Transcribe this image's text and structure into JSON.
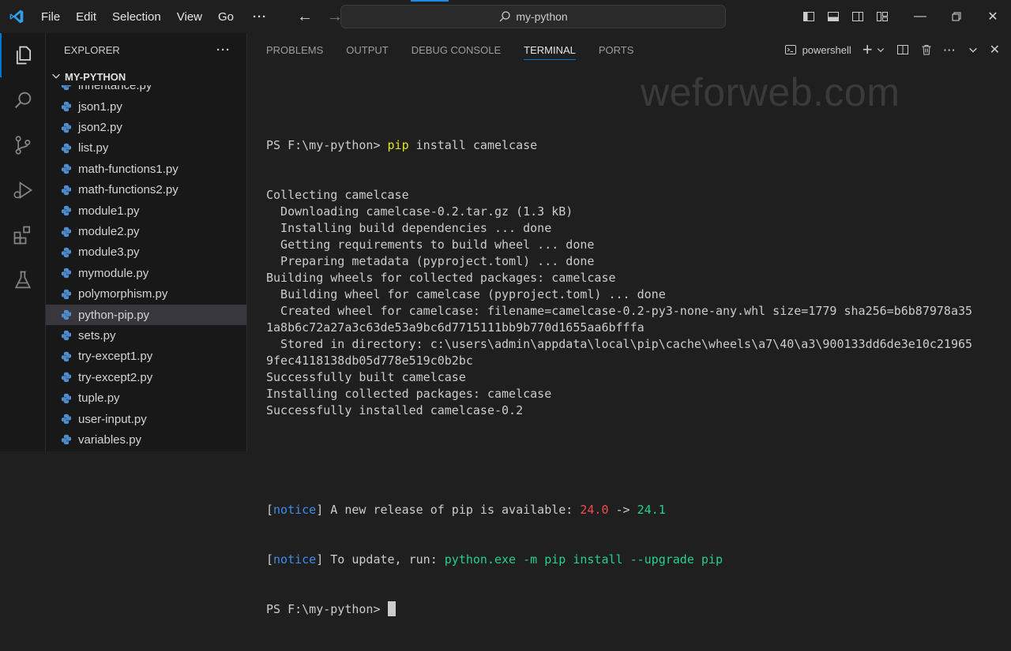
{
  "titlebar": {
    "menu": [
      "File",
      "Edit",
      "Selection",
      "View",
      "Go"
    ],
    "more": "···",
    "search_text": "my-python"
  },
  "sidebar": {
    "header": "EXPLORER",
    "header_more": "···",
    "folder": "MY-PYTHON",
    "partial_file": "inheritance.py",
    "files": [
      "json1.py",
      "json2.py",
      "list.py",
      "math-functions1.py",
      "math-functions2.py",
      "module1.py",
      "module2.py",
      "module3.py",
      "mymodule.py",
      "polymorphism.py",
      "python-pip.py",
      "sets.py",
      "try-except1.py",
      "try-except2.py",
      "tuple.py",
      "user-input.py",
      "variables.py"
    ],
    "selected_file": "python-pip.py"
  },
  "panel": {
    "tabs": [
      "PROBLEMS",
      "OUTPUT",
      "DEBUG CONSOLE",
      "TERMINAL",
      "PORTS"
    ],
    "active_tab": "TERMINAL",
    "shell_label": "powershell",
    "watermark": "weforweb.com"
  },
  "terminal": {
    "prompt1_prefix": "PS F:\\my-python> ",
    "prompt1_cmd": "pip",
    "prompt1_args": " install camelcase",
    "lines": [
      "Collecting camelcase",
      "  Downloading camelcase-0.2.tar.gz (1.3 kB)",
      "  Installing build dependencies ... done",
      "  Getting requirements to build wheel ... done",
      "  Preparing metadata (pyproject.toml) ... done",
      "Building wheels for collected packages: camelcase",
      "  Building wheel for camelcase (pyproject.toml) ... done",
      "  Created wheel for camelcase: filename=camelcase-0.2-py3-none-any.whl size=1779 sha256=b6b87978a35",
      "1a8b6c72a27a3c63de53a9bc6d7715111bb9b770d1655aa6bfffa",
      "  Stored in directory: c:\\users\\admin\\appdata\\local\\pip\\cache\\wheels\\a7\\40\\a3\\900133dd6de3e10c21965",
      "9fec4118138db05d778e519c0b2bc",
      "Successfully built camelcase",
      "Installing collected packages: camelcase",
      "Successfully installed camelcase-0.2"
    ],
    "notice_tag": "notice",
    "notice1_text": " A new release of pip is available: ",
    "old_version": "24.0",
    "arrow": " -> ",
    "new_version": "24.1",
    "notice2_text": " To update, run: ",
    "update_cmd": "python.exe -m pip install --upgrade pip",
    "prompt2": "PS F:\\my-python> "
  },
  "colors": {
    "accent": "#0078d4",
    "cmd_yellow": "#e5e510",
    "notice_blue": "#3b8eea",
    "old_red": "#f14c4c",
    "new_green": "#23d18b"
  }
}
